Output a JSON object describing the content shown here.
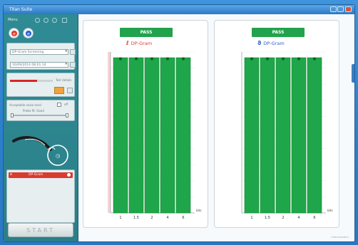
{
  "window": {
    "title": "Titan Suite",
    "colors": {
      "accent": "#2c7fcb",
      "sidebar": "#2f8b95",
      "pass": "#22a24d"
    }
  },
  "sidebar": {
    "toolbar_label": "Menu",
    "toolbar_icons": [
      "help-icon",
      "print-icon",
      "save-icon",
      "close-icon"
    ],
    "ear_buttons": [
      "right-ear-icon",
      "left-ear-icon"
    ],
    "protocol_select": "DP-Gram Screening",
    "session_select": "16/09/2014 08:01:14",
    "progress_fraction": 0.63,
    "show_details_label": "Test details",
    "probe_fit_label": "Acceptable noise level",
    "probe_fit_value": "off",
    "probe_level_label": "Probe fit: Good",
    "test_item": {
      "label": "DP-Gram",
      "icon": "ear-icon"
    },
    "start_label": "START"
  },
  "charts": [
    {
      "badge": "PASS",
      "title": "DP-Gram",
      "ear": "right",
      "ear_symbol": "ℓ",
      "ear_color": "#e0392b",
      "unit_label": "kHz"
    },
    {
      "badge": "PASS",
      "title": "DP-Gram",
      "ear": "left",
      "ear_symbol": "ϑ",
      "ear_color": "#2a5fd0",
      "unit_label": "kHz"
    }
  ],
  "chart_data": [
    {
      "type": "bar",
      "title": "DP-Gram",
      "categories": [
        "1",
        "1.5",
        "2",
        "4",
        "6"
      ],
      "values": [
        1,
        1,
        1,
        1,
        1
      ],
      "status": [
        "pass",
        "pass",
        "pass",
        "pass",
        "pass"
      ],
      "xlabel": "kHz",
      "ylabel": "",
      "ylim": [
        0,
        1
      ],
      "grid": true
    },
    {
      "type": "bar",
      "title": "DP-Gram",
      "categories": [
        "1",
        "1.5",
        "2",
        "4",
        "6"
      ],
      "values": [
        1,
        1,
        1,
        1,
        1
      ],
      "status": [
        "pass",
        "pass",
        "pass",
        "pass",
        "pass"
      ],
      "xlabel": "kHz",
      "ylabel": "",
      "ylim": [
        0,
        1
      ],
      "grid": true
    }
  ],
  "footer": {
    "brand_text": "interacoustics"
  }
}
